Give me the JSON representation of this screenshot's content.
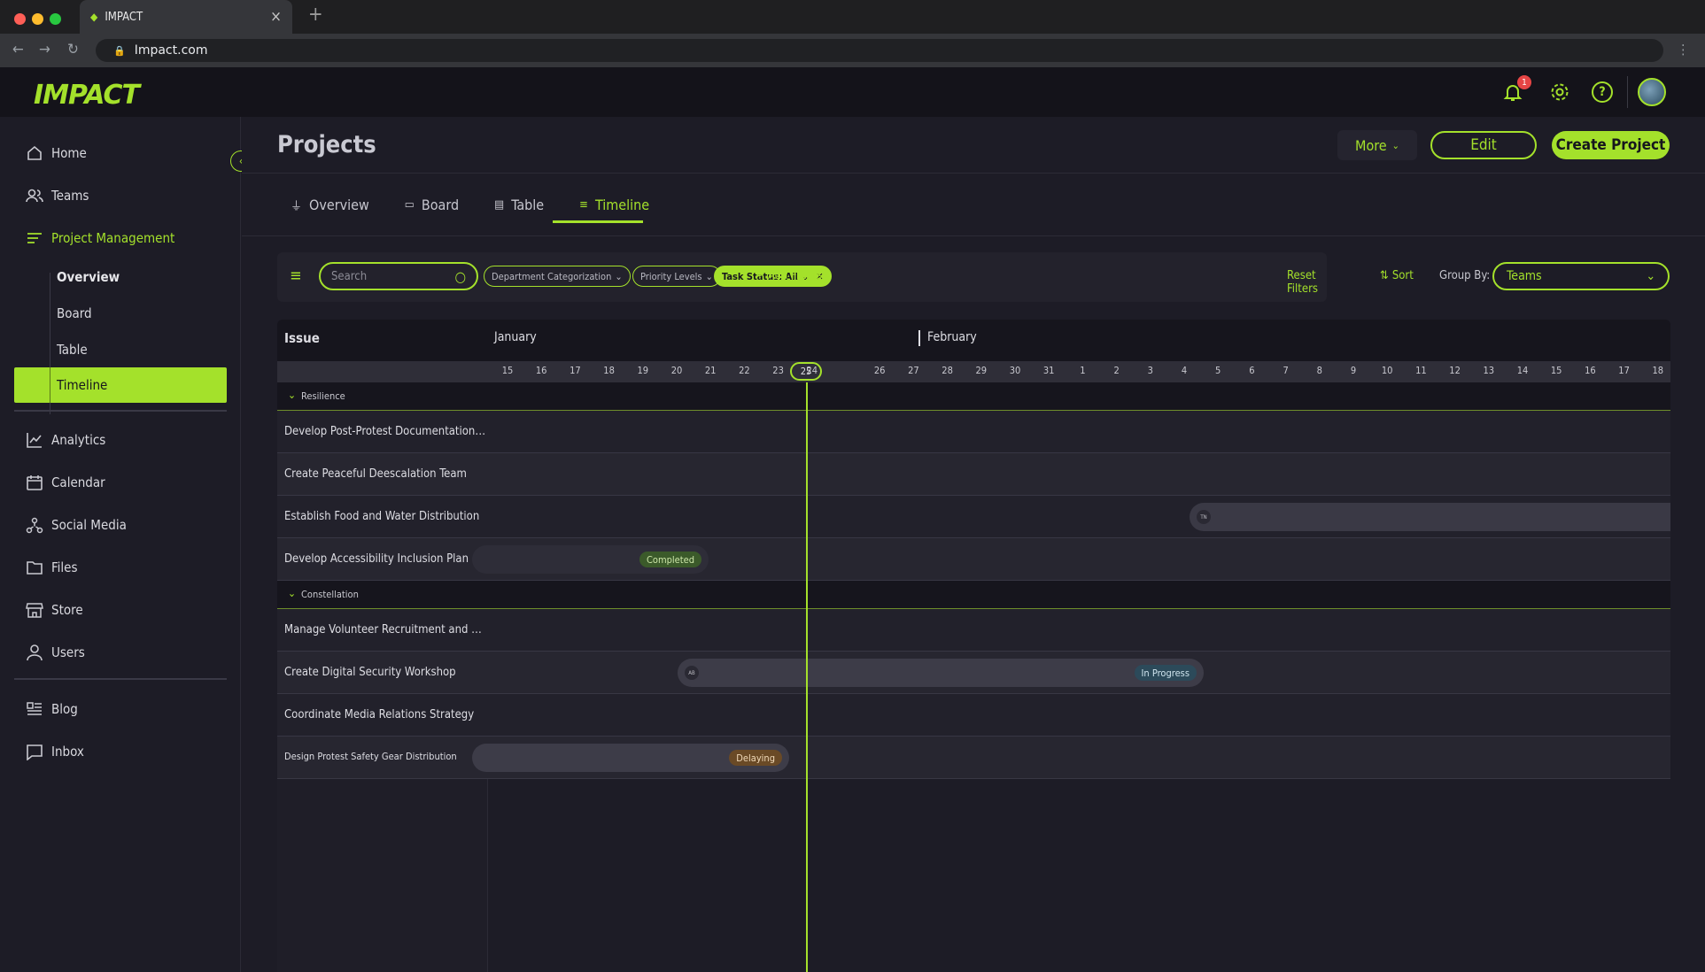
{
  "browser": {
    "tab_title": "IMPACT",
    "url": "Impact.com",
    "new_tab": "+",
    "close": "×"
  },
  "app": {
    "logo": "IMPACT",
    "notifications_count": "1"
  },
  "sidebar": {
    "items": [
      {
        "label": "Home",
        "icon": "home-icon"
      },
      {
        "label": "Teams",
        "icon": "users-icon"
      },
      {
        "label": "Project Management",
        "icon": "list-icon"
      },
      {
        "label": "Analytics",
        "icon": "chart-icon"
      },
      {
        "label": "Calendar",
        "icon": "calendar-icon"
      },
      {
        "label": "Social Media",
        "icon": "network-icon"
      },
      {
        "label": "Files",
        "icon": "folder-icon"
      },
      {
        "label": "Store",
        "icon": "store-icon"
      },
      {
        "label": "Users",
        "icon": "user-icon"
      },
      {
        "label": "Blog",
        "icon": "blog-icon"
      },
      {
        "label": "Inbox",
        "icon": "inbox-icon"
      }
    ],
    "sub_items": [
      "Overview",
      "Board",
      "Table",
      "Timeline"
    ]
  },
  "header": {
    "title": "Projects",
    "more": "More",
    "edit": "Edit",
    "create": "Create Project"
  },
  "tabs": [
    "Overview",
    "Board",
    "Table",
    "Timeline"
  ],
  "filters": {
    "search_placeholder": "Search",
    "department": "Department Categorization",
    "priority": "Priority Levels",
    "task_status": "Task Status: All",
    "add_filters": "Add Filters",
    "reset": "Reset Filters",
    "sort": "Sort",
    "group_by_label": "Group By:",
    "group_by_value": "Teams"
  },
  "timeline": {
    "issue_header": "Issue",
    "months": [
      "January",
      "February"
    ],
    "days": [
      "15",
      "16",
      "17",
      "18",
      "19",
      "20",
      "21",
      "22",
      "23",
      "24",
      "25",
      "26",
      "27",
      "28",
      "29",
      "30",
      "31",
      "1",
      "2",
      "3",
      "4",
      "5",
      "6",
      "7",
      "8",
      "9",
      "10",
      "11",
      "12",
      "13",
      "14",
      "15",
      "16",
      "17",
      "18"
    ],
    "today": "25",
    "groups": [
      {
        "name": "Resilience",
        "rows": [
          {
            "name": "Develop Post-Protest Documentation S…"
          },
          {
            "name": "Create Peaceful Deescalation Team"
          },
          {
            "name": "Establish Food and Water Distribution",
            "avatar": "TN"
          },
          {
            "name": "Develop Accessibility Inclusion Plan",
            "status": "Completed"
          }
        ]
      },
      {
        "name": "Constellation",
        "rows": [
          {
            "name": "Manage Volunteer Recruitment and Tra…"
          },
          {
            "name": "Create Digital Security Workshop",
            "avatar": "AB",
            "status": "In Progress"
          },
          {
            "name": "Coordinate Media Relations Strategy"
          },
          {
            "name": "Design Protest Safety Gear Distribution",
            "status": "Delaying"
          }
        ]
      }
    ]
  },
  "colors": {
    "accent": "#a4e12b",
    "completed": "#3b5a2a",
    "in_progress": "#2c4a5a",
    "delaying": "#6a4a26"
  }
}
